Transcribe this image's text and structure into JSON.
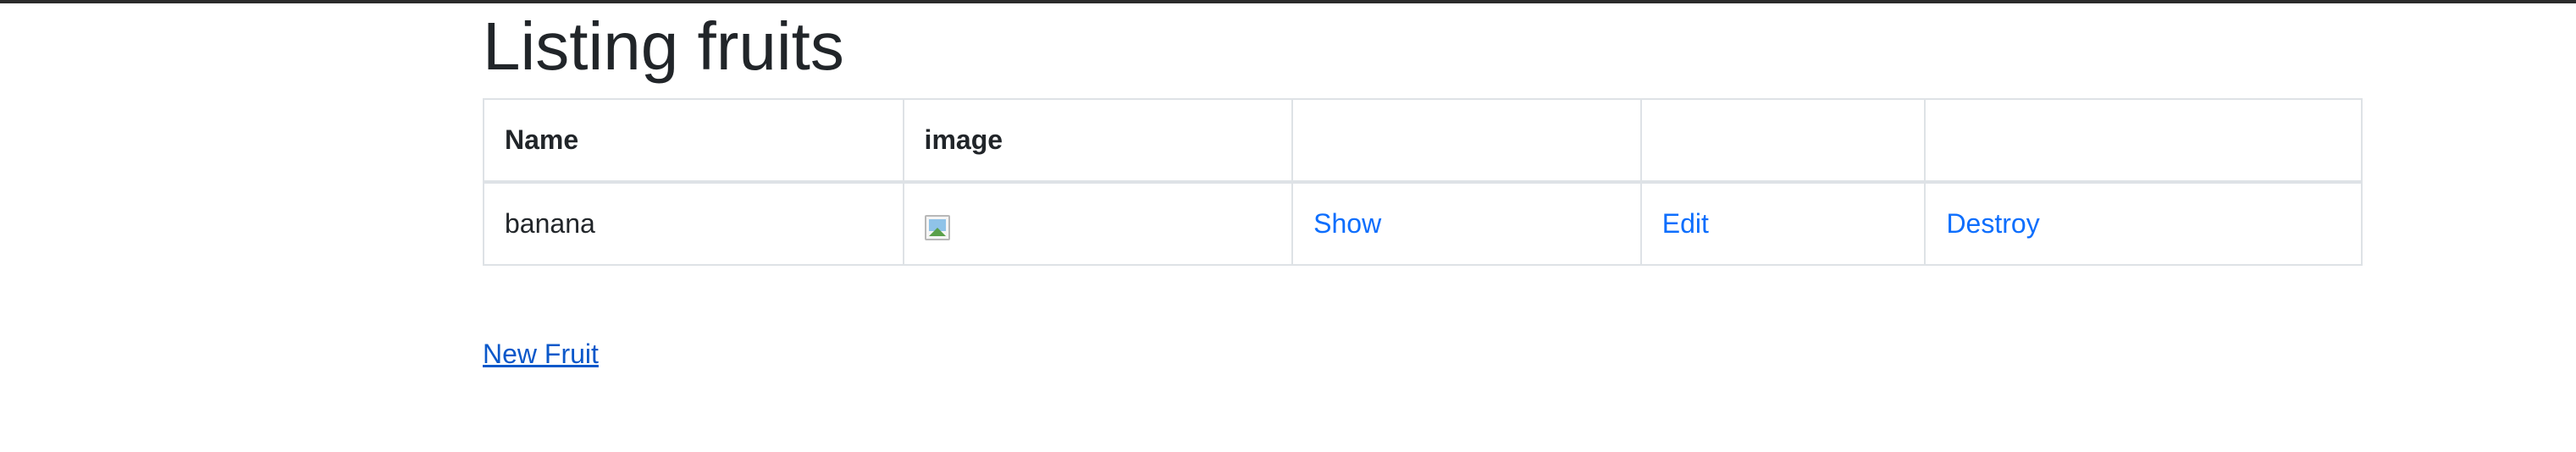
{
  "page": {
    "title": "Listing fruits"
  },
  "table": {
    "headers": [
      "Name",
      "image",
      "",
      "",
      ""
    ],
    "rows": [
      {
        "name": "banana",
        "image_icon": "broken-image-icon",
        "show_label": "Show",
        "edit_label": "Edit",
        "destroy_label": "Destroy"
      }
    ]
  },
  "actions": {
    "new_label": "New Fruit"
  },
  "colors": {
    "link": "#0d6efd",
    "visited_link": "#0a58ca",
    "border": "#dee2e6",
    "text": "#212529"
  }
}
